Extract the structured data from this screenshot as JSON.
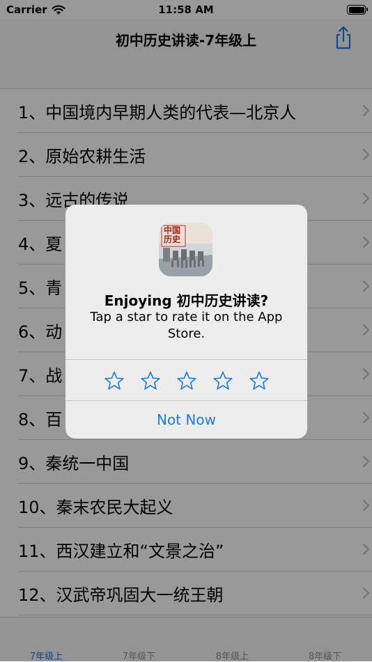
{
  "status_bar": {
    "carrier": "Carrier",
    "time": "11:58 AM"
  },
  "nav": {
    "title": "初中历史讲读-7年级上",
    "share_icon": "share-icon"
  },
  "lessons": [
    "1、中国境内早期人类的代表—北京人",
    "2、原始农耕生活",
    "3、远古的传说",
    "4、夏",
    "5、青",
    "6、动",
    "7、战",
    "8、百",
    "9、秦统一中国",
    "10、秦末农民大起义",
    "11、西汉建立和“文景之治”",
    "12、汉武帝巩固大一统王朝"
  ],
  "tabs": [
    "7年级上",
    "7年级下",
    "8年级上",
    "8年级下"
  ],
  "active_tab": 0,
  "alert": {
    "title": "Enjoying 初中历史讲读?",
    "message": "Tap a star to rate it on the App Store.",
    "stars": 5,
    "not_now": "Not Now",
    "app_icon_text": "中国历史"
  },
  "colors": {
    "accent": "#1a7bf0",
    "tab_active": "#1a73d9",
    "separator": "#d6d6d8"
  }
}
